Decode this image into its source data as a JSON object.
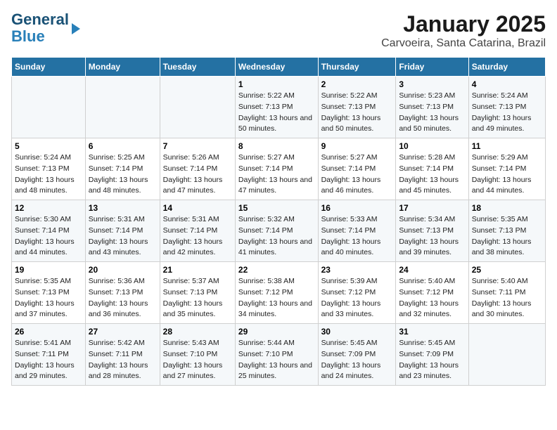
{
  "header": {
    "logo_line1": "General",
    "logo_line2": "Blue",
    "title": "January 2025",
    "subtitle": "Carvoeira, Santa Catarina, Brazil"
  },
  "days_of_week": [
    "Sunday",
    "Monday",
    "Tuesday",
    "Wednesday",
    "Thursday",
    "Friday",
    "Saturday"
  ],
  "weeks": [
    [
      {
        "day": "",
        "sunrise": "",
        "sunset": "",
        "daylight": ""
      },
      {
        "day": "",
        "sunrise": "",
        "sunset": "",
        "daylight": ""
      },
      {
        "day": "",
        "sunrise": "",
        "sunset": "",
        "daylight": ""
      },
      {
        "day": "1",
        "sunrise": "Sunrise: 5:22 AM",
        "sunset": "Sunset: 7:13 PM",
        "daylight": "Daylight: 13 hours and 50 minutes."
      },
      {
        "day": "2",
        "sunrise": "Sunrise: 5:22 AM",
        "sunset": "Sunset: 7:13 PM",
        "daylight": "Daylight: 13 hours and 50 minutes."
      },
      {
        "day": "3",
        "sunrise": "Sunrise: 5:23 AM",
        "sunset": "Sunset: 7:13 PM",
        "daylight": "Daylight: 13 hours and 50 minutes."
      },
      {
        "day": "4",
        "sunrise": "Sunrise: 5:24 AM",
        "sunset": "Sunset: 7:13 PM",
        "daylight": "Daylight: 13 hours and 49 minutes."
      }
    ],
    [
      {
        "day": "5",
        "sunrise": "Sunrise: 5:24 AM",
        "sunset": "Sunset: 7:13 PM",
        "daylight": "Daylight: 13 hours and 48 minutes."
      },
      {
        "day": "6",
        "sunrise": "Sunrise: 5:25 AM",
        "sunset": "Sunset: 7:14 PM",
        "daylight": "Daylight: 13 hours and 48 minutes."
      },
      {
        "day": "7",
        "sunrise": "Sunrise: 5:26 AM",
        "sunset": "Sunset: 7:14 PM",
        "daylight": "Daylight: 13 hours and 47 minutes."
      },
      {
        "day": "8",
        "sunrise": "Sunrise: 5:27 AM",
        "sunset": "Sunset: 7:14 PM",
        "daylight": "Daylight: 13 hours and 47 minutes."
      },
      {
        "day": "9",
        "sunrise": "Sunrise: 5:27 AM",
        "sunset": "Sunset: 7:14 PM",
        "daylight": "Daylight: 13 hours and 46 minutes."
      },
      {
        "day": "10",
        "sunrise": "Sunrise: 5:28 AM",
        "sunset": "Sunset: 7:14 PM",
        "daylight": "Daylight: 13 hours and 45 minutes."
      },
      {
        "day": "11",
        "sunrise": "Sunrise: 5:29 AM",
        "sunset": "Sunset: 7:14 PM",
        "daylight": "Daylight: 13 hours and 44 minutes."
      }
    ],
    [
      {
        "day": "12",
        "sunrise": "Sunrise: 5:30 AM",
        "sunset": "Sunset: 7:14 PM",
        "daylight": "Daylight: 13 hours and 44 minutes."
      },
      {
        "day": "13",
        "sunrise": "Sunrise: 5:31 AM",
        "sunset": "Sunset: 7:14 PM",
        "daylight": "Daylight: 13 hours and 43 minutes."
      },
      {
        "day": "14",
        "sunrise": "Sunrise: 5:31 AM",
        "sunset": "Sunset: 7:14 PM",
        "daylight": "Daylight: 13 hours and 42 minutes."
      },
      {
        "day": "15",
        "sunrise": "Sunrise: 5:32 AM",
        "sunset": "Sunset: 7:14 PM",
        "daylight": "Daylight: 13 hours and 41 minutes."
      },
      {
        "day": "16",
        "sunrise": "Sunrise: 5:33 AM",
        "sunset": "Sunset: 7:14 PM",
        "daylight": "Daylight: 13 hours and 40 minutes."
      },
      {
        "day": "17",
        "sunrise": "Sunrise: 5:34 AM",
        "sunset": "Sunset: 7:13 PM",
        "daylight": "Daylight: 13 hours and 39 minutes."
      },
      {
        "day": "18",
        "sunrise": "Sunrise: 5:35 AM",
        "sunset": "Sunset: 7:13 PM",
        "daylight": "Daylight: 13 hours and 38 minutes."
      }
    ],
    [
      {
        "day": "19",
        "sunrise": "Sunrise: 5:35 AM",
        "sunset": "Sunset: 7:13 PM",
        "daylight": "Daylight: 13 hours and 37 minutes."
      },
      {
        "day": "20",
        "sunrise": "Sunrise: 5:36 AM",
        "sunset": "Sunset: 7:13 PM",
        "daylight": "Daylight: 13 hours and 36 minutes."
      },
      {
        "day": "21",
        "sunrise": "Sunrise: 5:37 AM",
        "sunset": "Sunset: 7:13 PM",
        "daylight": "Daylight: 13 hours and 35 minutes."
      },
      {
        "day": "22",
        "sunrise": "Sunrise: 5:38 AM",
        "sunset": "Sunset: 7:12 PM",
        "daylight": "Daylight: 13 hours and 34 minutes."
      },
      {
        "day": "23",
        "sunrise": "Sunrise: 5:39 AM",
        "sunset": "Sunset: 7:12 PM",
        "daylight": "Daylight: 13 hours and 33 minutes."
      },
      {
        "day": "24",
        "sunrise": "Sunrise: 5:40 AM",
        "sunset": "Sunset: 7:12 PM",
        "daylight": "Daylight: 13 hours and 32 minutes."
      },
      {
        "day": "25",
        "sunrise": "Sunrise: 5:40 AM",
        "sunset": "Sunset: 7:11 PM",
        "daylight": "Daylight: 13 hours and 30 minutes."
      }
    ],
    [
      {
        "day": "26",
        "sunrise": "Sunrise: 5:41 AM",
        "sunset": "Sunset: 7:11 PM",
        "daylight": "Daylight: 13 hours and 29 minutes."
      },
      {
        "day": "27",
        "sunrise": "Sunrise: 5:42 AM",
        "sunset": "Sunset: 7:11 PM",
        "daylight": "Daylight: 13 hours and 28 minutes."
      },
      {
        "day": "28",
        "sunrise": "Sunrise: 5:43 AM",
        "sunset": "Sunset: 7:10 PM",
        "daylight": "Daylight: 13 hours and 27 minutes."
      },
      {
        "day": "29",
        "sunrise": "Sunrise: 5:44 AM",
        "sunset": "Sunset: 7:10 PM",
        "daylight": "Daylight: 13 hours and 25 minutes."
      },
      {
        "day": "30",
        "sunrise": "Sunrise: 5:45 AM",
        "sunset": "Sunset: 7:09 PM",
        "daylight": "Daylight: 13 hours and 24 minutes."
      },
      {
        "day": "31",
        "sunrise": "Sunrise: 5:45 AM",
        "sunset": "Sunset: 7:09 PM",
        "daylight": "Daylight: 13 hours and 23 minutes."
      },
      {
        "day": "",
        "sunrise": "",
        "sunset": "",
        "daylight": ""
      }
    ]
  ]
}
